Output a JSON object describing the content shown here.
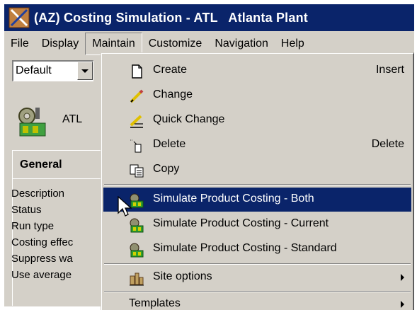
{
  "window": {
    "title": "(AZ) Costing Simulation - ATL   Atlanta Plant"
  },
  "menubar": [
    {
      "label": "File"
    },
    {
      "label": "Display"
    },
    {
      "label": "Maintain",
      "active": true
    },
    {
      "label": "Customize"
    },
    {
      "label": "Navigation"
    },
    {
      "label": "Help"
    }
  ],
  "left_pane": {
    "layout_select": "Default",
    "plant_code": "ATL",
    "tab_general": "General",
    "fields": [
      "Description",
      "Status",
      "Run type",
      "Costing effec",
      "Suppress wa",
      "Use average"
    ]
  },
  "maintain_menu": {
    "items": [
      {
        "label": "Create",
        "shortcut": "Insert",
        "icon": "create-icon"
      },
      {
        "label": "Change",
        "shortcut": "",
        "icon": "change-icon"
      },
      {
        "label": "Quick Change",
        "shortcut": "",
        "icon": "quick-change-icon"
      },
      {
        "label": "Delete",
        "shortcut": "Delete",
        "icon": "delete-icon"
      },
      {
        "label": "Copy",
        "shortcut": "",
        "icon": "copy-icon"
      },
      {
        "label": "Simulate Product Costing - Both",
        "icon": "simulate-icon",
        "highlighted": true
      },
      {
        "label": "Simulate Product Costing - Current",
        "icon": "simulate-icon"
      },
      {
        "label": "Simulate Product Costing - Standard",
        "icon": "simulate-icon"
      },
      {
        "label": "Site options",
        "icon": "site-options-icon",
        "submenu": true
      },
      {
        "label": "Templates",
        "submenu": true
      }
    ]
  },
  "colors": {
    "titlebar": "#0a246a",
    "highlight": "#0a246a",
    "face": "#d4d0c8"
  }
}
